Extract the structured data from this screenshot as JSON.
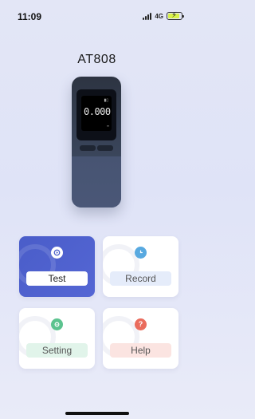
{
  "status_bar": {
    "time": "11:09",
    "network": "4G"
  },
  "device": {
    "name": "AT808",
    "screen_reading": "0.000"
  },
  "menu": {
    "test": {
      "label": "Test",
      "icon": "play-icon",
      "color": "#4a5dc9"
    },
    "record": {
      "label": "Record",
      "icon": "clock-icon",
      "color": "#58a9e0"
    },
    "setting": {
      "label": "Setting",
      "icon": "settings-icon",
      "color": "#5cc38f"
    },
    "help": {
      "label": "Help",
      "icon": "question-icon",
      "color": "#ea6c5d"
    }
  }
}
